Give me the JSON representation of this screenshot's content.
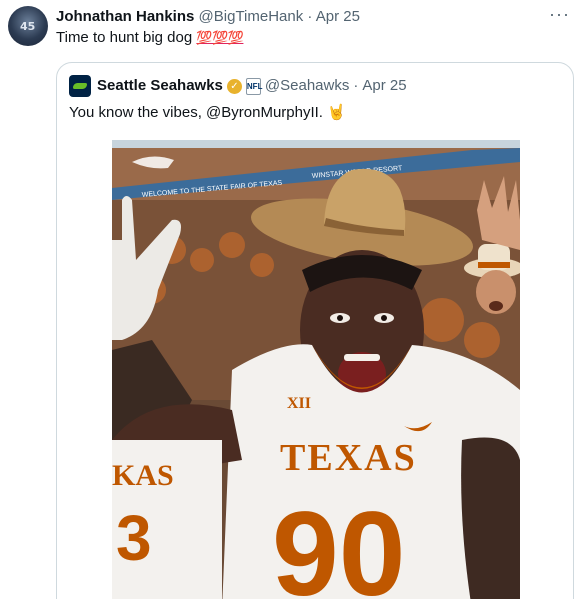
{
  "tweet": {
    "author_name": "Johnathan Hankins",
    "author_handle": "@BigTimeHank",
    "separator": "·",
    "date": "Apr 25",
    "text": "Time to hunt big dog",
    "emoji": "💯💯💯",
    "more_icon": "more-horizontal-icon"
  },
  "quoted": {
    "author_name": "Seattle Seahawks",
    "author_handle": "@Seahawks",
    "separator": "·",
    "date": "Apr 25",
    "text": "You know the vibes, @ByronMurphyII.",
    "emoji": "🤘",
    "verified_icon": "gold-verified-icon",
    "affiliate_icon": "nfl-badge-icon",
    "nfl_label": "NFL"
  },
  "photo": {
    "banner_text": "WELCOME TO THE STATE FAIR OF TEXAS",
    "banner_text_2": "WINSTAR WORLD RESORT",
    "jersey_text": "TEXAS",
    "jersey_number": "90",
    "side_jersey_text": "KAS",
    "side_jersey_number": "3",
    "conference_logo": "XII",
    "colors": {
      "orange": "#bf5700",
      "white": "#f3f1ee",
      "crowd": "#8a5a3c"
    }
  }
}
